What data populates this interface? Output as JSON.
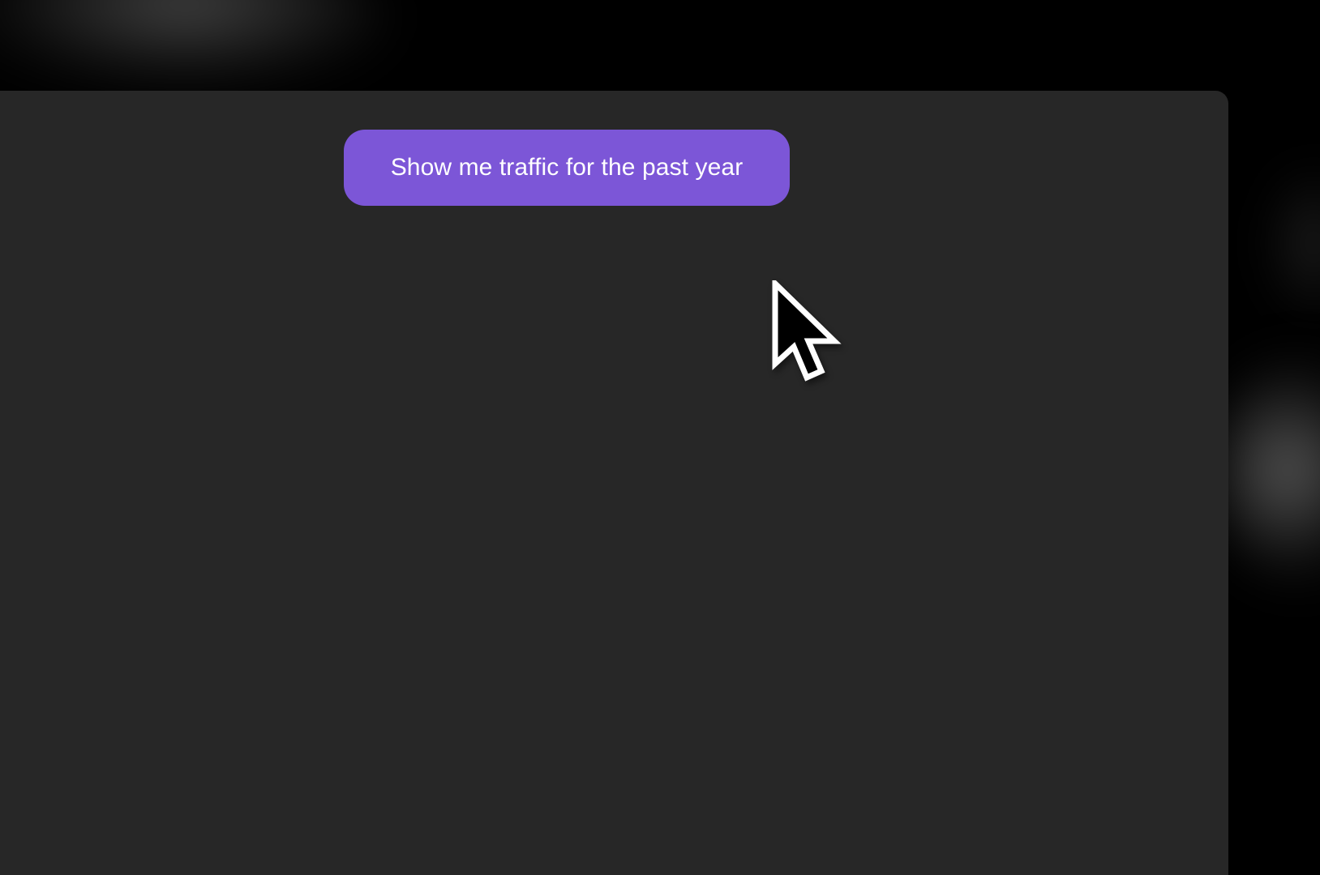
{
  "background": {
    "color": "#000000",
    "panel_color": "#272727"
  },
  "prompt": {
    "label": "Show me traffic for the past year",
    "color": "#7C56D7",
    "text_color": "#FFFFFF"
  },
  "pointer": {
    "icon": "mouse-pointer-arrow-icon"
  }
}
